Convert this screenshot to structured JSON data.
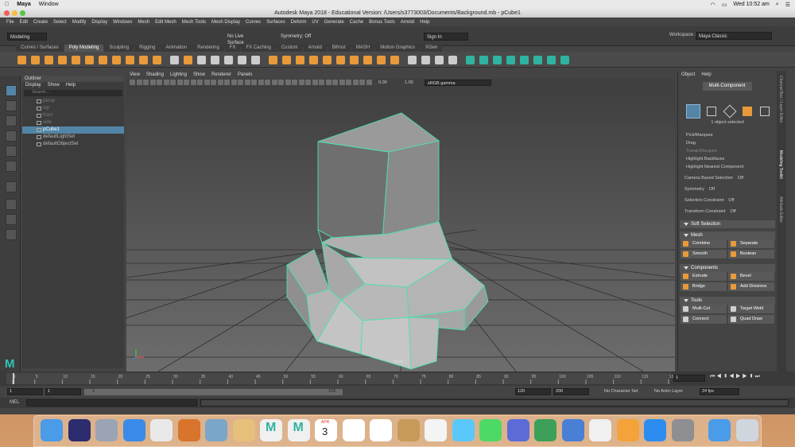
{
  "macmenu": {
    "app": "Maya",
    "window": "Window",
    "clock": "Wed 10:52 am"
  },
  "window": {
    "title": "Autodesk Maya 2018 - Educational Version: /Users/s3773003/Documents/Background.mb - pCube1"
  },
  "menubar": [
    "File",
    "Edit",
    "Create",
    "Select",
    "Modify",
    "Display",
    "Windows",
    "Mesh",
    "Edit Mesh",
    "Mesh Tools",
    "Mesh Display",
    "Curves",
    "Surfaces",
    "Deform",
    "UV",
    "Generate",
    "Cache",
    "Bonus Tools",
    "Arnold",
    "Help"
  ],
  "status": {
    "mode": "Modeling",
    "live": "No Live Surface",
    "symmetry": "Symmetry: Off",
    "signin": "Sign In",
    "workspace_label": "Workspace :",
    "workspace": "Maya Classic"
  },
  "shelf_tabs": [
    "Curves / Surfaces",
    "Poly Modeling",
    "Sculpting",
    "Rigging",
    "Animation",
    "Rendering",
    "FX",
    "FX Caching",
    "Custom",
    "Arnold",
    "Bifrost",
    "MASH",
    "Motion Graphics",
    "XGen"
  ],
  "outliner": {
    "title": "Outliner",
    "menu": [
      "Display",
      "Show",
      "Help"
    ],
    "search": "Search...",
    "items": [
      "persp",
      "top",
      "front",
      "side",
      "pCube1",
      "defaultLightSet",
      "defaultObjectSet"
    ]
  },
  "viewport": {
    "menu": [
      "View",
      "Shading",
      "Lighting",
      "Show",
      "Renderer",
      "Panels"
    ],
    "val1": "0.00",
    "val2": "1.00",
    "gamma": "sRGB gamma",
    "camera": "persp"
  },
  "attr": {
    "menu": [
      "Object",
      "Help"
    ],
    "mode": "Multi-Component",
    "selected": "1 object selected",
    "pick": [
      "Pick/Marquee",
      "Drag",
      "Tweak/Marquee",
      "Highlight Backfaces",
      "Highlight Nearest Component"
    ],
    "rows": [
      {
        "label": "Camera Based Selection",
        "value": "Off"
      },
      {
        "label": "Symmetry",
        "value": "Off"
      },
      {
        "label": "Selection Constraint",
        "value": "Off"
      },
      {
        "label": "Transform Constraint",
        "value": "Off"
      }
    ],
    "soft": "Soft Selection",
    "sections": {
      "mesh": "Mesh",
      "components": "Components",
      "tools": "Tools"
    },
    "mesh_buttons": [
      "Combine",
      "Separate",
      "Smooth",
      "Boolean"
    ],
    "comp_buttons": [
      "Extrude",
      "Bevel",
      "Bridge",
      "Add Divisions"
    ],
    "tool_buttons": [
      "Multi-Cut",
      "Target Weld",
      "Connect",
      "Quad Draw"
    ]
  },
  "sidetabs": [
    "Channel Box / Layer Editor",
    "Modeling Toolkit",
    "Attribute Editor"
  ],
  "timeline": {
    "ticks": [
      "1",
      "5",
      "10",
      "15",
      "20",
      "25",
      "30",
      "35",
      "40",
      "45",
      "50",
      "55",
      "60",
      "65",
      "70",
      "75",
      "80",
      "85",
      "90",
      "95",
      "100",
      "105",
      "110",
      "115",
      "120"
    ],
    "current": "1"
  },
  "range": {
    "start": "1",
    "start2": "1",
    "slider_start": "1",
    "slider_end": "120",
    "end": "120",
    "end2": "200",
    "char": "No Character Set",
    "anim": "No Anim Layer",
    "fps": "24 fps"
  },
  "mel": {
    "label": "MEL"
  },
  "colors": {
    "wire": "#4de0b0",
    "selection": "#5285a6",
    "accent": "#e89a3a"
  },
  "dock": [
    "Finder",
    "Siri",
    "Launchpad",
    "Safari",
    "Chrome",
    "Photos",
    "Preview",
    "Notes",
    "Maya",
    "Maya",
    "Calendar",
    "Notes",
    "Reminders",
    "Contacts",
    "Photos",
    "Messages",
    "FaceTime",
    "Keynote",
    "Numbers",
    "Keynote",
    "iTunes",
    "iBooks",
    "App Store",
    "System Preferences",
    "Downloads",
    "Trash"
  ],
  "calendar": {
    "month": "APR",
    "day": "3"
  }
}
